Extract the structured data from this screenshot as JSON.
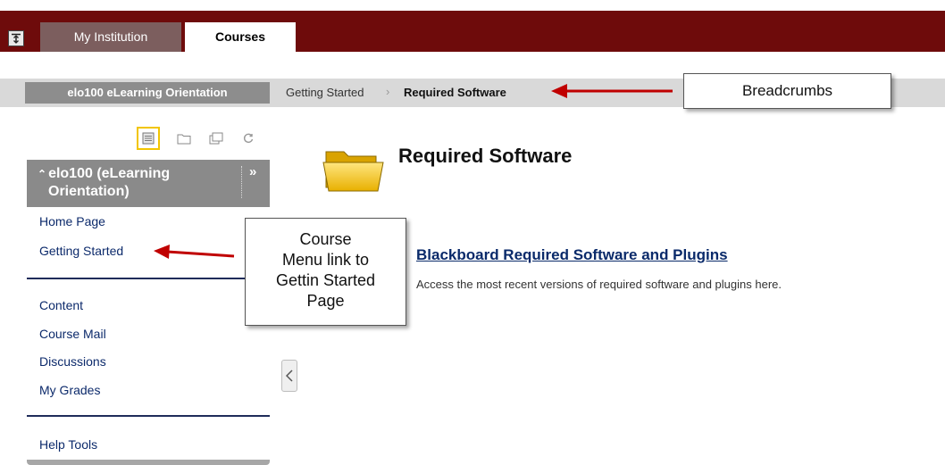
{
  "tabs": {
    "my_institution": "My Institution",
    "courses": "Courses"
  },
  "breadcrumb": {
    "course": "elo100 eLearning Orientation",
    "items": [
      "Getting Started",
      "Required Software"
    ],
    "separator": "›"
  },
  "callouts": {
    "breadcrumbs": "Breadcrumbs",
    "course_menu_lines": [
      "Course",
      "Menu link to",
      "Gettin Started",
      "Page"
    ]
  },
  "sidebar": {
    "course_title_line1": "elo100 (eLearning",
    "course_title_line2": "Orientation)",
    "items_group1": [
      "Home Page",
      "Getting Started"
    ],
    "items_group2": [
      "Content",
      "Course Mail",
      "Discussions",
      "My Grades"
    ],
    "items_group3": [
      "Help Tools"
    ]
  },
  "main": {
    "page_title": "Required Software",
    "item_title": "Blackboard Required Software and Plugins",
    "item_description": "Access the most recent versions of required software and plugins here."
  },
  "colors": {
    "header_maroon": "#6e0b0b",
    "arrow_red": "#c00000",
    "link_navy": "#0c2a6b"
  }
}
